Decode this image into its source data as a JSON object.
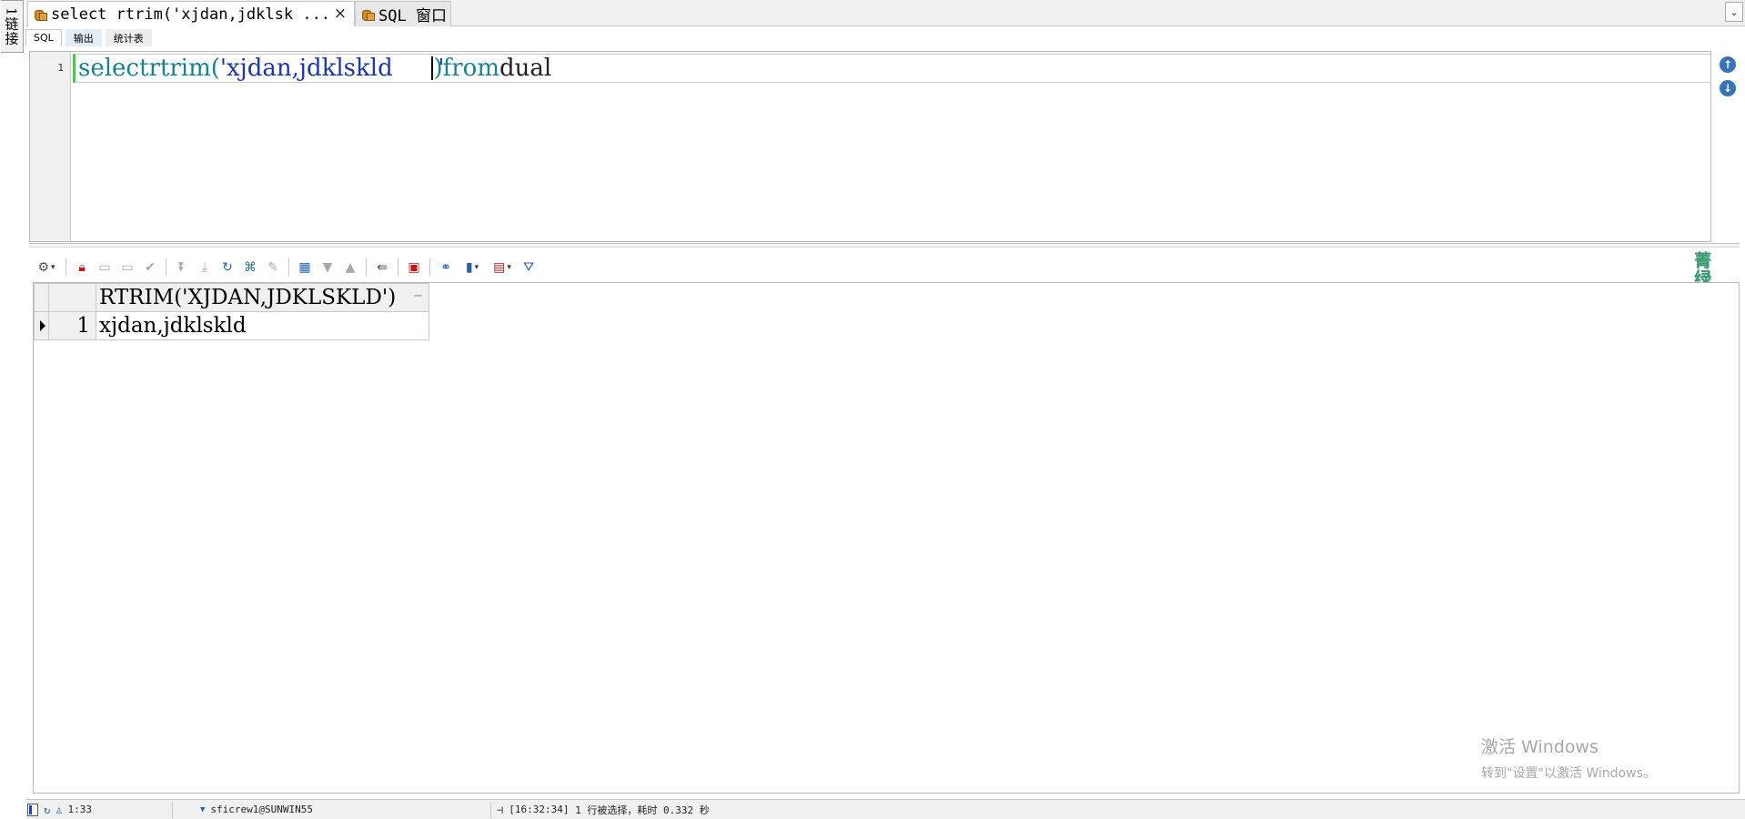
{
  "connection_tab": {
    "label": "1链接"
  },
  "doc_tabs": [
    {
      "label": "select rtrim('xjdan,jdklsk ...",
      "active": true,
      "close": "×"
    },
    {
      "label": "SQL 窗口",
      "active": false
    }
  ],
  "sub_tabs": [
    "SQL",
    "输出",
    "统计表"
  ],
  "editor": {
    "line_number": "1",
    "code": {
      "kw1": "select",
      "fn": "rtrim(",
      "str": "'xjdan,jdklskld      '",
      "close": ")",
      "kw2": "from",
      "tbl": "dual"
    }
  },
  "nav_buttons": {
    "up": "↑",
    "down": "↓"
  },
  "stamp_text": "菁绿青石板街",
  "grid": {
    "columns": [
      "RTRIM('XJDAN,JDKLSKLD')"
    ],
    "sort_icon": "−",
    "rows": [
      {
        "num": "1",
        "values": [
          "xjdan,jdklskld"
        ]
      }
    ]
  },
  "activation": {
    "line1": "激活 Windows",
    "line2": "转到\"设置\"以激活 Windows。"
  },
  "status": {
    "position": "1:33",
    "connection": "sficrew1@SUNWIN55",
    "timestamp": "[16:32:34]",
    "message": "1 行被选择，耗时 0.332 秒"
  },
  "colors": {
    "keyword": "#17838e",
    "string": "#1c36b0",
    "accent": "#3a74b8"
  }
}
